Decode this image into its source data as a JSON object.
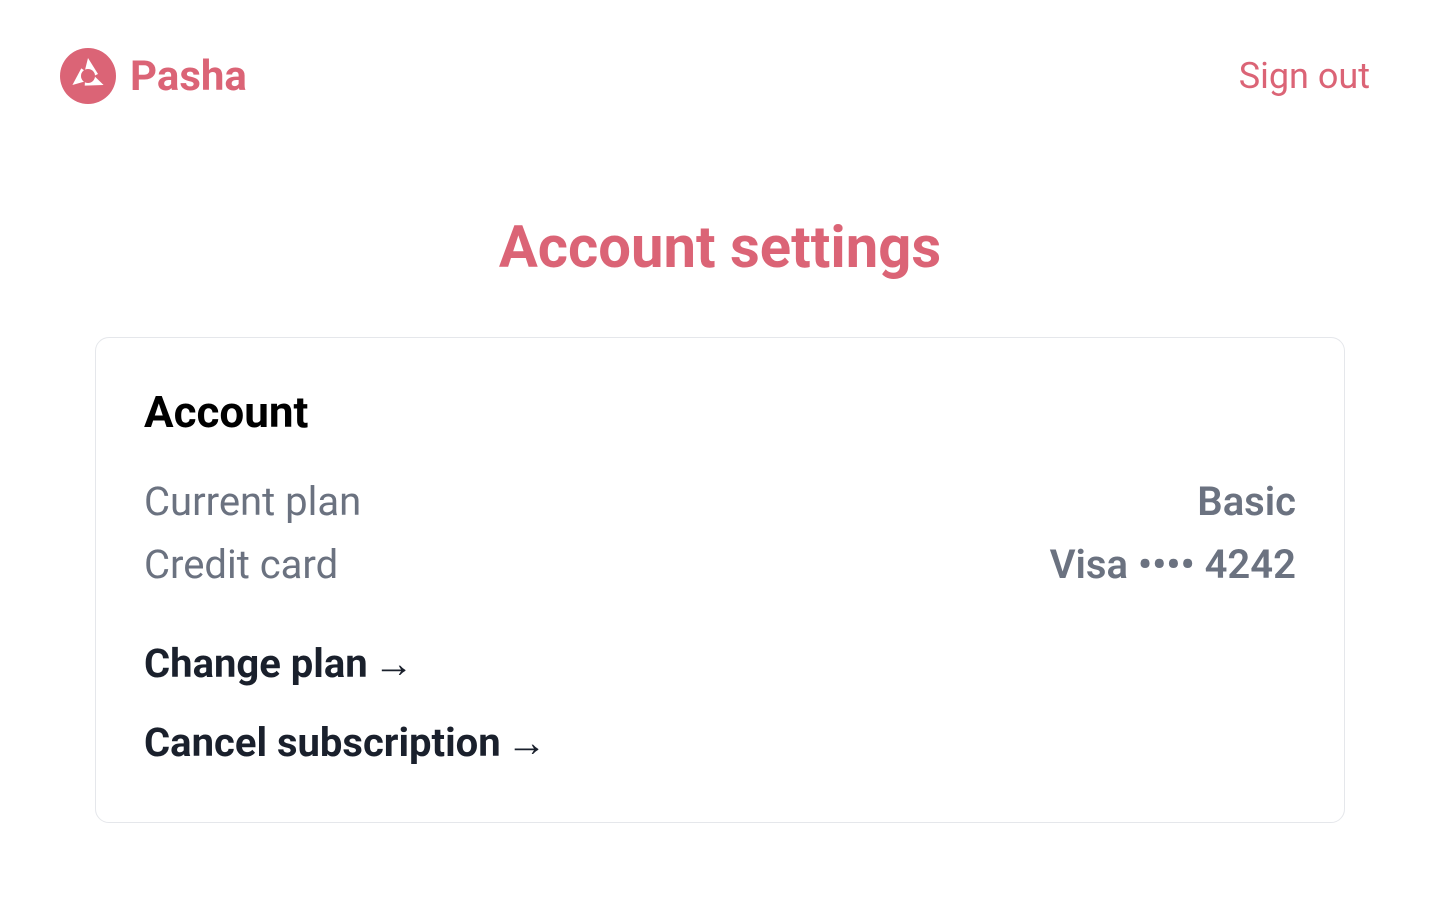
{
  "header": {
    "brand_name": "Pasha",
    "sign_out_label": "Sign out"
  },
  "page": {
    "title": "Account settings"
  },
  "account": {
    "section_title": "Account",
    "rows": {
      "plan_label": "Current plan",
      "plan_value": "Basic",
      "card_label": "Credit card",
      "card_value": "Visa •••• 4242"
    },
    "actions": {
      "change_plan_label": "Change plan",
      "cancel_subscription_label": "Cancel subscription",
      "arrow": "→"
    }
  }
}
